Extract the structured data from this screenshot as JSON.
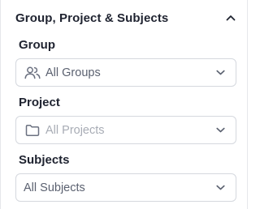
{
  "section": {
    "title": "Group, Project & Subjects",
    "expanded": true
  },
  "group": {
    "label": "Group",
    "value": "All Groups",
    "icon": "users-icon"
  },
  "project": {
    "label": "Project",
    "value": "All Projects",
    "icon": "folder-icon",
    "disabled": true
  },
  "subjects": {
    "label": "Subjects",
    "value": "All Subjects"
  },
  "colors": {
    "text": "#1f2330",
    "muted": "#5b6170",
    "disabled": "#a8acb5",
    "border": "#d5d8de"
  }
}
